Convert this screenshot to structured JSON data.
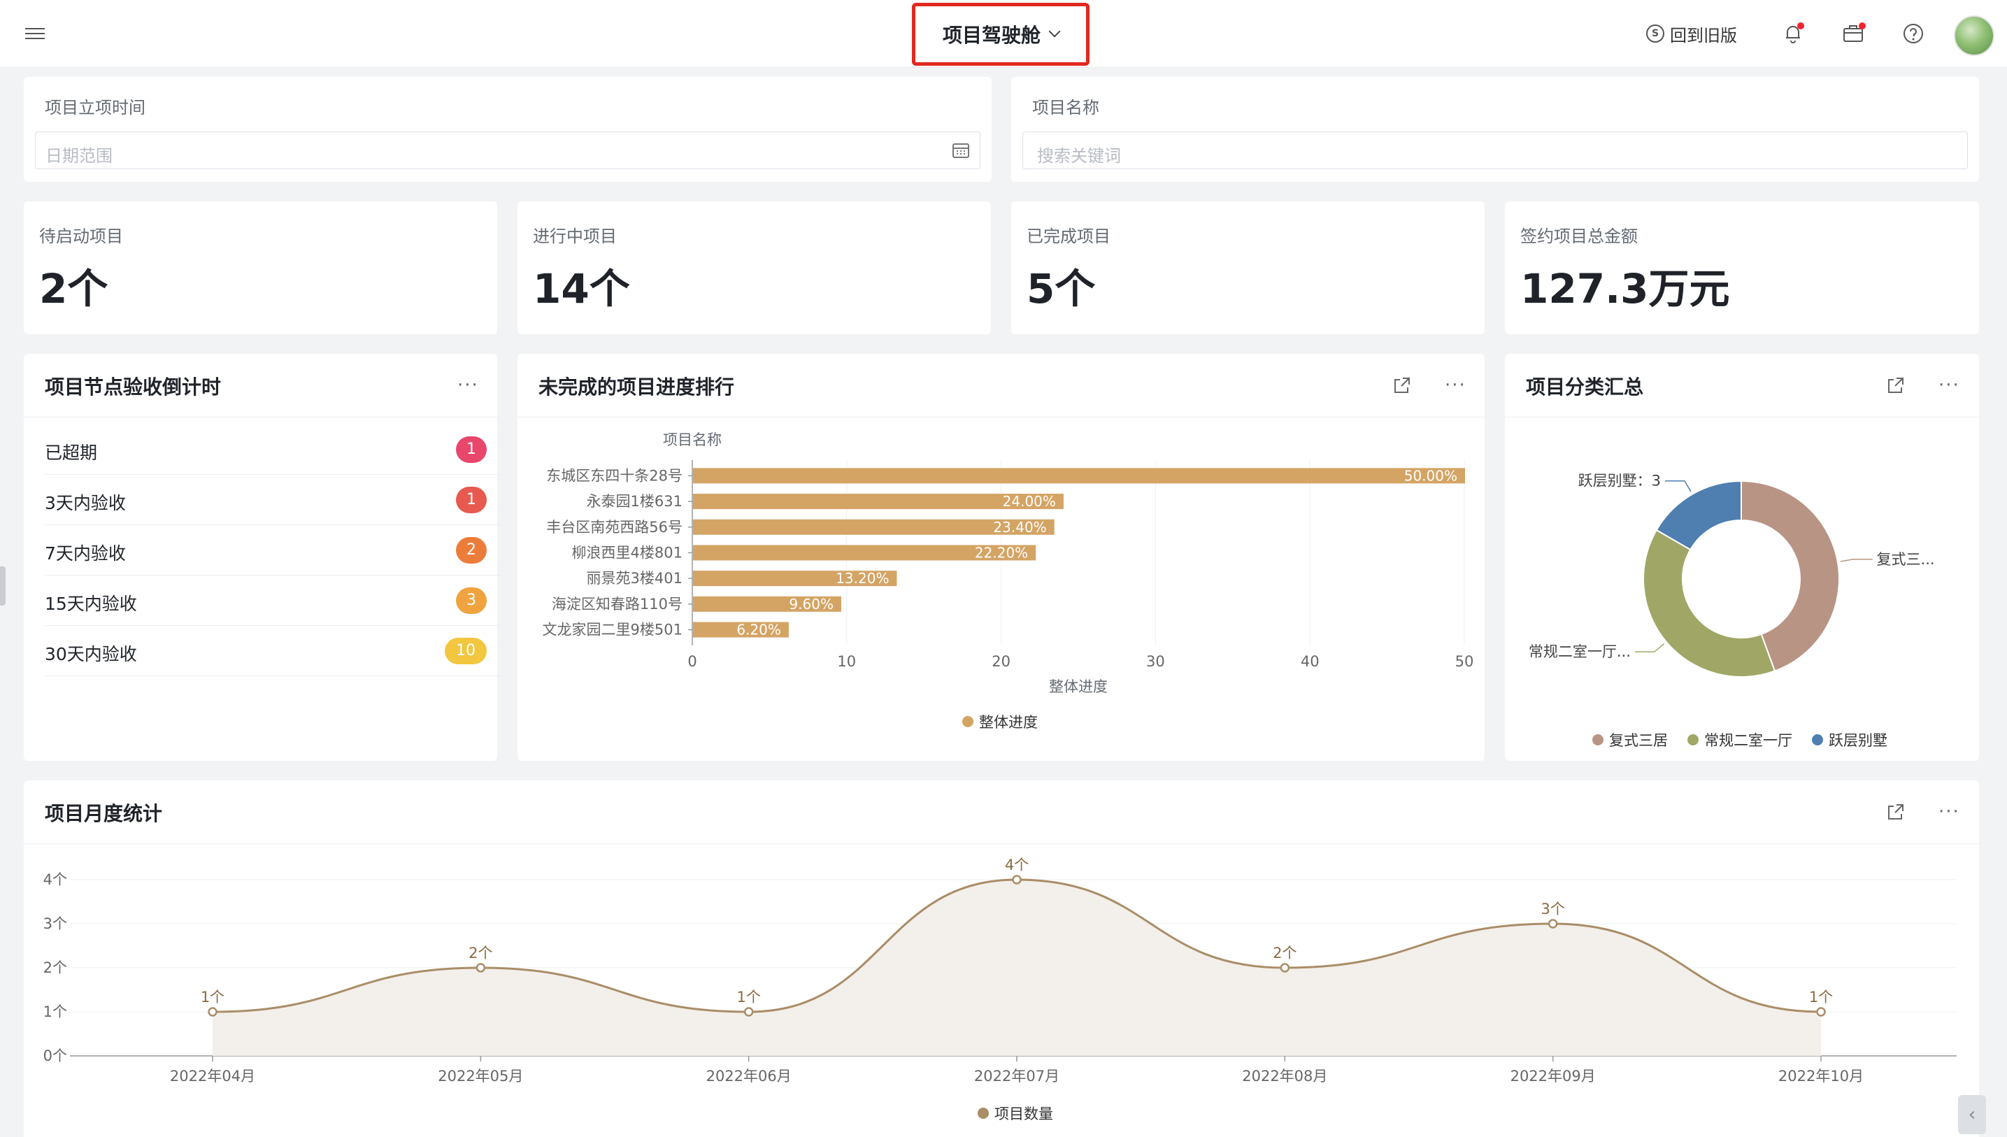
{
  "header": {
    "title": "项目驾驶舱",
    "back_old": "回到旧版",
    "icons": {
      "menu": "hamburger-icon",
      "coin": "coin-icon",
      "bell": "bell-icon",
      "briefcase": "briefcase-icon",
      "help": "help-icon",
      "avatar": "avatar"
    }
  },
  "filters": {
    "date": {
      "label": "项目立项时间",
      "placeholder": "日期范围"
    },
    "name": {
      "label": "项目名称",
      "placeholder": "搜索关键词"
    }
  },
  "stats": [
    {
      "label": "待启动项目",
      "value": "2个"
    },
    {
      "label": "进行中项目",
      "value": "14个"
    },
    {
      "label": "已完成项目",
      "value": "5个"
    },
    {
      "label": "签约项目总金额",
      "value": "127.3万元"
    }
  ],
  "countdown": {
    "title": "项目节点验收倒计时",
    "rows": [
      {
        "label": "已超期",
        "count": "1",
        "color": "#e8466b"
      },
      {
        "label": "3天内验收",
        "count": "1",
        "color": "#e85a4f"
      },
      {
        "label": "7天内验收",
        "count": "2",
        "color": "#ec7c3a"
      },
      {
        "label": "15天内验收",
        "count": "3",
        "color": "#efa43f"
      },
      {
        "label": "30天内验收",
        "count": "10",
        "color": "#f3c63f"
      }
    ]
  },
  "colors": {
    "bar": "#d4a464",
    "line": "#a98d67",
    "donut": [
      "#b89485",
      "#a0a766",
      "#4f7fb0"
    ]
  },
  "chart_data": [
    {
      "type": "bar",
      "title": "未完成的项目进度排行",
      "ylabel": "项目名称",
      "xlabel": "整体进度",
      "categories": [
        "东城区东四十条28号",
        "永泰园1楼631",
        "丰台区南苑西路56号",
        "柳浪西里4楼801",
        "丽景苑3楼401",
        "海淀区知春路110号",
        "文龙家园二里9楼501"
      ],
      "series": [
        {
          "name": "整体进度",
          "values": [
            50.0,
            24.0,
            23.4,
            22.2,
            13.2,
            9.6,
            6.2
          ]
        }
      ],
      "data_labels": [
        "50.00%",
        "24.00%",
        "23.40%",
        "22.20%",
        "13.20%",
        "9.60%",
        "6.20%"
      ],
      "xlim": [
        0,
        50
      ],
      "xticks": [
        "0",
        "10",
        "20",
        "30",
        "40",
        "50"
      ],
      "legend": "bottom-center",
      "grid": true
    },
    {
      "type": "pie",
      "title": "项目分类汇总",
      "categories": [
        "复式三居",
        "常规二室一厅",
        "跃层别墅"
      ],
      "values": [
        8,
        7,
        3
      ],
      "slice_labels": [
        "复式三...",
        "常规二室一厅...",
        "跃层别墅：3"
      ],
      "legend": "bottom-center"
    },
    {
      "type": "area",
      "title": "项目月度统计",
      "x": [
        "2022年04月",
        "2022年05月",
        "2022年06月",
        "2022年07月",
        "2022年08月",
        "2022年09月",
        "2022年10月"
      ],
      "series": [
        {
          "name": "项目数量",
          "values": [
            1,
            2,
            1,
            4,
            2,
            3,
            1
          ]
        }
      ],
      "data_labels": [
        "1个",
        "2个",
        "1个",
        "4个",
        "2个",
        "3个",
        "1个"
      ],
      "ylim": [
        0,
        4
      ],
      "yticks": [
        "0个",
        "1个",
        "2个",
        "3个",
        "4个"
      ],
      "legend": "bottom-center",
      "grid": true
    }
  ]
}
